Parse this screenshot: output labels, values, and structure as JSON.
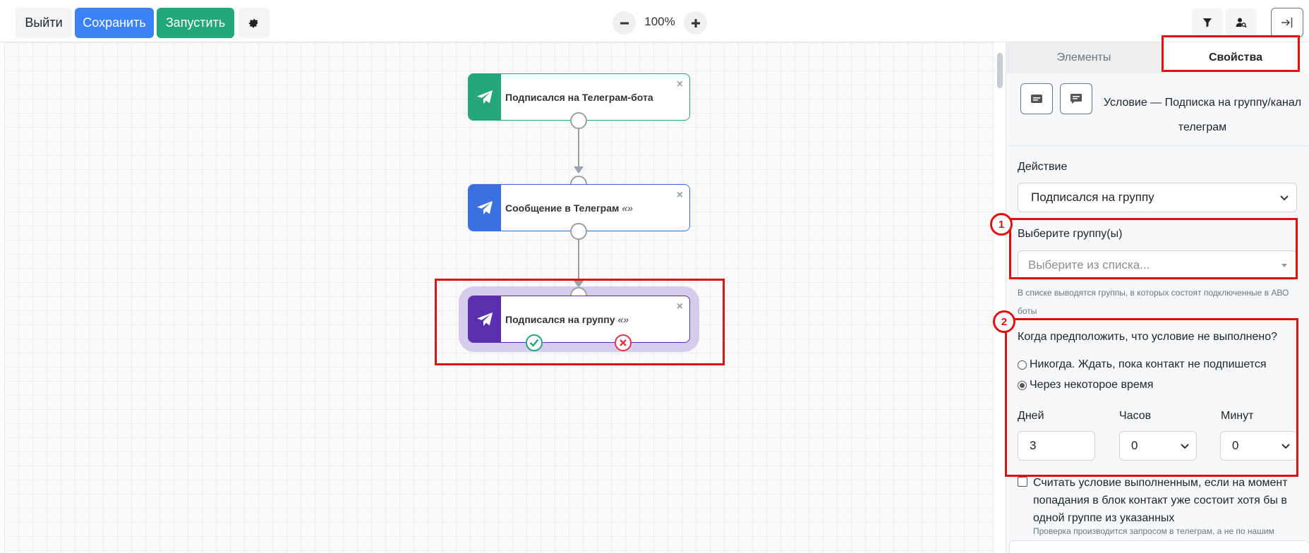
{
  "toolbar": {
    "exit_label": "Выйти",
    "save_label": "Сохранить",
    "run_label": "Запустить",
    "zoom": "100%"
  },
  "colors": {
    "primary": "#3b82f6",
    "success": "#22a77a",
    "trigger": "#27a57a",
    "message": "#3b6fe0",
    "condition": "#5b2eb0",
    "highlight": "#e01010"
  },
  "canvas": {
    "nodes": [
      {
        "title": "Подписался на Телеграм-бота",
        "subtitle": "",
        "icon": "telegram-icon"
      },
      {
        "title": "Сообщение в Телеграм",
        "subtitle": "«»",
        "icon": "telegram-icon"
      },
      {
        "title": "Подписался на группу",
        "subtitle": "«»",
        "icon": "telegram-icon"
      }
    ],
    "close_glyph": "×"
  },
  "annotations": {
    "badge1": "1",
    "badge2": "2"
  },
  "panel": {
    "tabs": [
      {
        "label": "Элементы"
      },
      {
        "label": "Свойства"
      }
    ],
    "title": "Условие — Подписка на группу/канал телеграм",
    "action_label": "Действие",
    "action_value": "Подписался на группу",
    "groups_label": "Выберите группу(ы)",
    "groups_placeholder": "Выберите из списка...",
    "groups_hint": "В списке выводятся группы, в которых состоят подключенные в АВО боты",
    "condition_question": "Когда предположить, что условие не выполнено?",
    "radio_never": "Никогда. Ждать, пока контакт не подпишется",
    "radio_after": "Через некоторое время",
    "days_label": "Дней",
    "hours_label": "Часов",
    "minutes_label": "Минут",
    "days_value": "3",
    "hours_value": "0",
    "minutes_value": "0",
    "checkbox_text": "Считать условие выполненным, если на момент попадания в блок контакт уже состоит хотя бы в одной группе из указанных",
    "checkbox_hint": "Проверка производится запросом в телеграм, а не по нашим"
  }
}
